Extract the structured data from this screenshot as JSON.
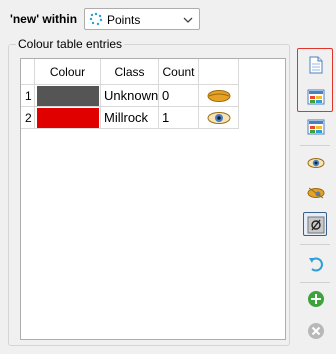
{
  "header": {
    "within_label": "'new' within",
    "dropdown_value": "Points"
  },
  "group": {
    "title": "Colour table entries"
  },
  "table": {
    "columns": [
      "Colour",
      "Class",
      "Count"
    ],
    "rows": [
      {
        "index": "1",
        "colour": "#555555",
        "class": "Unknown",
        "count": "0",
        "visibility_icon": "eye-closed-icon"
      },
      {
        "index": "2",
        "colour": "#e00000",
        "class": "Millrock",
        "count": "1",
        "visibility_icon": "eye-open-icon"
      }
    ]
  },
  "toolbar": {
    "buttons": [
      {
        "name": "new-document-button",
        "icon": "document-icon"
      },
      {
        "name": "colour-table-button",
        "icon": "colour-table-icon"
      },
      {
        "name": "colour-table-alt-button",
        "icon": "colour-table-icon"
      },
      {
        "name": "show-all-button",
        "icon": "eye-open-icon"
      },
      {
        "name": "toggle-visibility-button",
        "icon": "eye-split-icon"
      },
      {
        "name": "null-button",
        "icon": "null-icon"
      },
      {
        "name": "undo-button",
        "icon": "undo-icon"
      },
      {
        "name": "add-button",
        "icon": "plus-circle-icon"
      },
      {
        "name": "remove-button",
        "icon": "close-circle-icon"
      }
    ]
  },
  "colors": {
    "accent": "#3a5f8a",
    "highlight": "#e0352b",
    "add_green": "#3da33b"
  }
}
